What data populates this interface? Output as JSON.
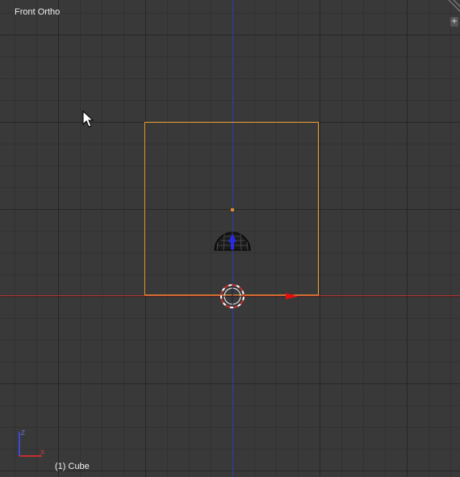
{
  "viewport": {
    "view_name": "Front Ortho",
    "object_label": "(1) Cube",
    "add_button_label": "+",
    "colors": {
      "background": "#393939",
      "x_axis": "#c03030",
      "z_axis": "#2a3db0",
      "selection_outline": "#f0a030",
      "origin_dot": "#d08a40",
      "lamp_arrow": "#2a2ae0",
      "x_arrow": "#e01010"
    },
    "gizmo": {
      "z_label": "Z",
      "x_label": "X"
    },
    "icons": [
      "mouse-pointer-icon",
      "3d-cursor-icon",
      "lamp-icon",
      "origin-dot-icon",
      "x-arrow-icon",
      "corner-resize-icon",
      "add-icon"
    ]
  }
}
